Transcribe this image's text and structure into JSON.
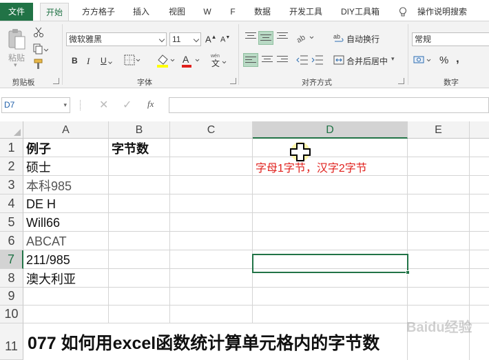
{
  "tabs": [
    "文件",
    "开始",
    "方方格子",
    "插入",
    "视图",
    "W",
    "F",
    "数据",
    "开发工具",
    "DIY工具箱",
    "操作说明搜索"
  ],
  "ribbon": {
    "clipboard": {
      "paste_label": "粘贴",
      "group_label": "剪贴板"
    },
    "font": {
      "name": "微软雅黑",
      "size": "11",
      "group_label": "字体"
    },
    "alignment": {
      "wrap_label": "自动换行",
      "merge_label": "合并后居中",
      "group_label": "对齐方式"
    },
    "number": {
      "format": "常规",
      "group_label": "数字",
      "percent": "%",
      "comma": ","
    }
  },
  "formula_bar": {
    "name_box": "D7",
    "formula": ""
  },
  "columns": [
    "A",
    "B",
    "C",
    "D",
    "E"
  ],
  "rows": [
    "1",
    "2",
    "3",
    "4",
    "5",
    "6",
    "7",
    "8",
    "9",
    "10",
    "11"
  ],
  "cells": {
    "A1": "例子",
    "B1": "字节数",
    "A2": "硕士",
    "D2": "字母1字节，汉字2字节",
    "A3": "本科985",
    "A4": "DE H",
    "A5": "Will66",
    "A6": "ABCAT",
    "A7": "211/985",
    "A8": "澳大利亚",
    "A11": "077 如何用excel函数统计算单元格内的字节数"
  },
  "watermark": "Baidu经验",
  "colors": {
    "accent": "#217346",
    "red_text": "#e0201c"
  }
}
